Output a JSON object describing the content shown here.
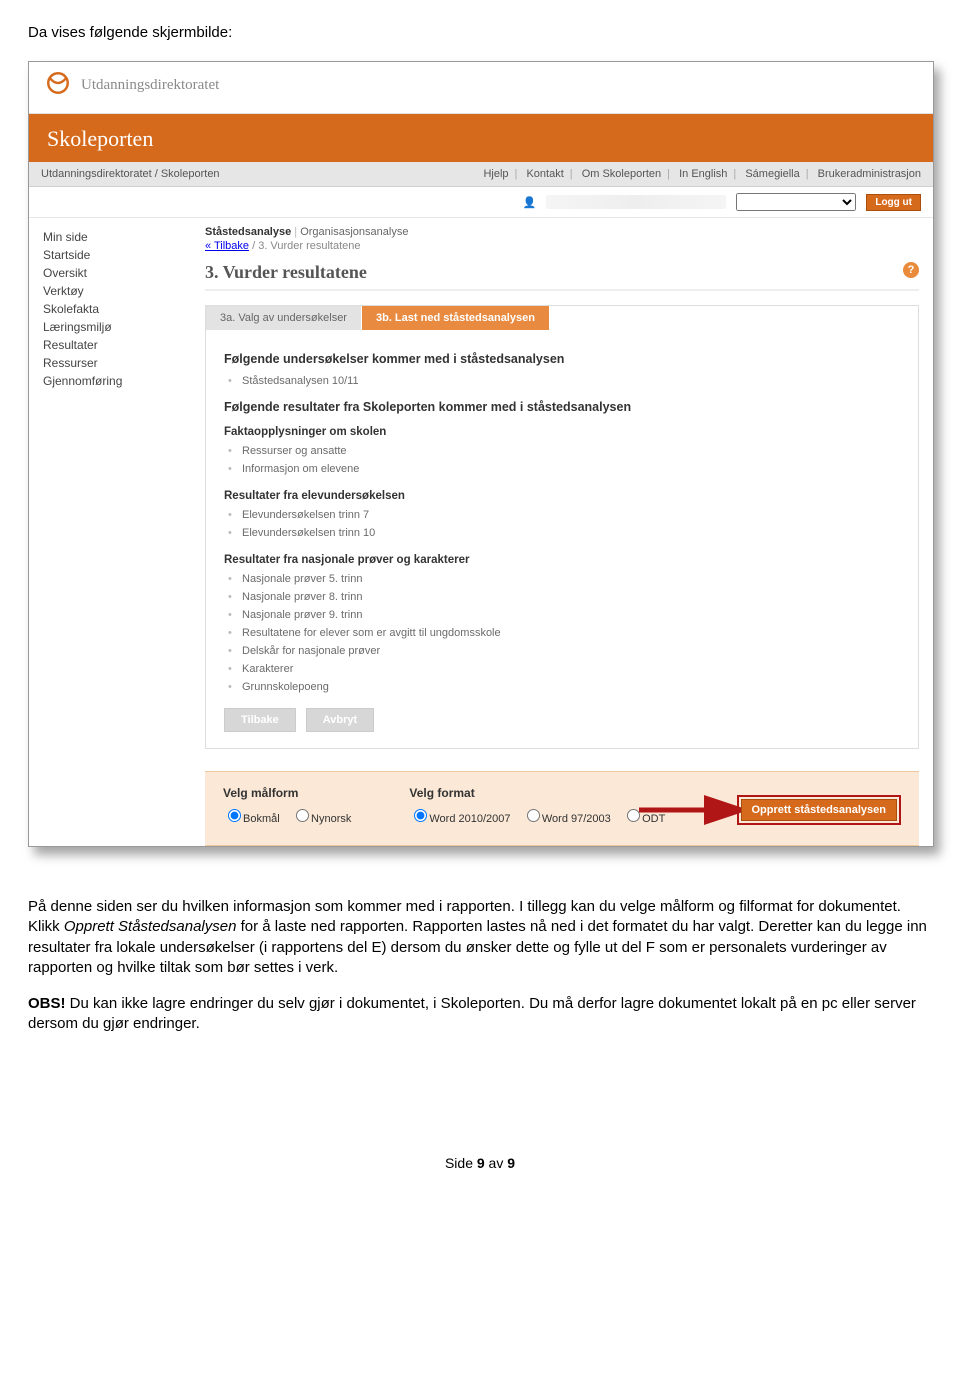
{
  "doc": {
    "intro": "Da vises følgende skjermbilde:",
    "para1_a": "På denne siden ser du hvilken informasjon som kommer med i rapporten. I tillegg kan du velge målform og filformat for dokumentet. Klikk ",
    "para1_em": "Opprett Ståstedsanalysen",
    "para1_b": " for å laste ned rapporten. Rapporten lastes nå ned i det formatet du har valgt. Deretter kan du legge inn resultater fra lokale undersøkelser (i rapportens del E) dersom du ønsker dette og fylle ut del F som er personalets vurderinger av rapporten og hvilke tiltak som bør settes i verk.",
    "para2_strong": "OBS!",
    "para2": " Du kan ikke lagre endringer du selv gjør i dokumentet, i Skoleporten. Du må derfor lagre dokumentet lokalt på en pc eller server dersom du gjør endringer.",
    "footer_a": "Side ",
    "footer_b": "9",
    "footer_c": " av ",
    "footer_d": "9"
  },
  "shot": {
    "logo_text": "Utdanningsdirektoratet",
    "banner": "Skoleporten",
    "crumb_left": "Utdanningsdirektoratet / Skoleporten",
    "top_links": [
      "Hjelp",
      "Kontakt",
      "Om Skoleporten",
      "In English",
      "Sámegiella",
      "Brukeradministrasjon"
    ],
    "logout": "Logg ut",
    "sidebar": [
      "Min side",
      "Startside",
      "Oversikt",
      "Verktøy",
      "Skolefakta",
      "Læringsmiljø",
      "Resultater",
      "Ressurser",
      "Gjennomføring"
    ],
    "ana_tab1": "Ståstedsanalyse",
    "ana_tab2": "Organisasjonsanalyse",
    "back": "« Tilbake",
    "back_tail": " / 3. Vurder resultatene",
    "h3": "3. Vurder resultatene",
    "step_a": "3a. Valg av undersøkelser",
    "step_b": "3b. Last ned ståstedsanalysen",
    "h4a": "Følgende undersøkelser kommer med i ståstedsanalysen",
    "list_a": [
      "Ståstedsanalysen 10/11"
    ],
    "h4b": "Følgende resultater fra Skoleporten kommer med i ståstedsanalysen",
    "h5a": "Faktaopplysninger om skolen",
    "list_b": [
      "Ressurser og ansatte",
      "Informasjon om elevene"
    ],
    "h5b": "Resultater fra elevundersøkelsen",
    "list_c": [
      "Elevundersøkelsen trinn 7",
      "Elevundersøkelsen trinn 10"
    ],
    "h5c": "Resultater fra nasjonale prøver og karakterer",
    "list_d": [
      "Nasjonale prøver 5. trinn",
      "Nasjonale prøver 8. trinn",
      "Nasjonale prøver 9. trinn",
      "Resultatene for elever som er avgitt til ungdomsskole",
      "Delskår for nasjonale prøver",
      "Karakterer",
      "Grunnskolepoeng"
    ],
    "btn_back": "Tilbake",
    "btn_cancel": "Avbryt",
    "velg_mal": "Velg målform",
    "velg_fmt": "Velg format",
    "radios_mal": [
      "Bokmål",
      "Nynorsk"
    ],
    "radios_fmt": [
      "Word 2010/2007",
      "Word 97/2003",
      "ODT"
    ],
    "create": "Opprett ståstedsanalysen"
  }
}
